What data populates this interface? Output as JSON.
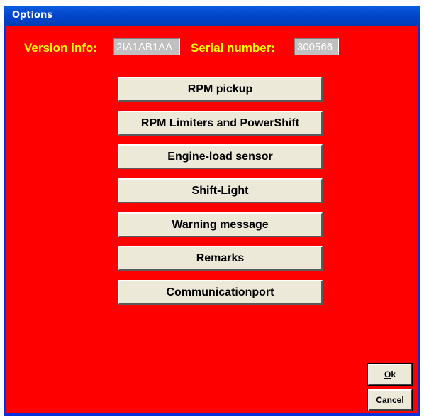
{
  "window": {
    "title": "Options",
    "background_color": "#ff0000",
    "titlebar_color": "#0045c8"
  },
  "info": {
    "version_label": "Version info:",
    "version_value": "2IA1AB1AA",
    "serial_label": "Serial number:",
    "serial_value": "300566",
    "label_color": "#ffff00"
  },
  "options": [
    {
      "label": "RPM pickup"
    },
    {
      "label": "RPM Limiters and PowerShift"
    },
    {
      "label": "Engine-load sensor"
    },
    {
      "label": "Shift-Light"
    },
    {
      "label": "Warning message"
    },
    {
      "label": "Remarks"
    },
    {
      "label": "Communicationport"
    }
  ],
  "dialog_buttons": {
    "ok_mnemonic": "O",
    "ok_rest": "k",
    "cancel_mnemonic": "C",
    "cancel_rest": "ancel"
  }
}
